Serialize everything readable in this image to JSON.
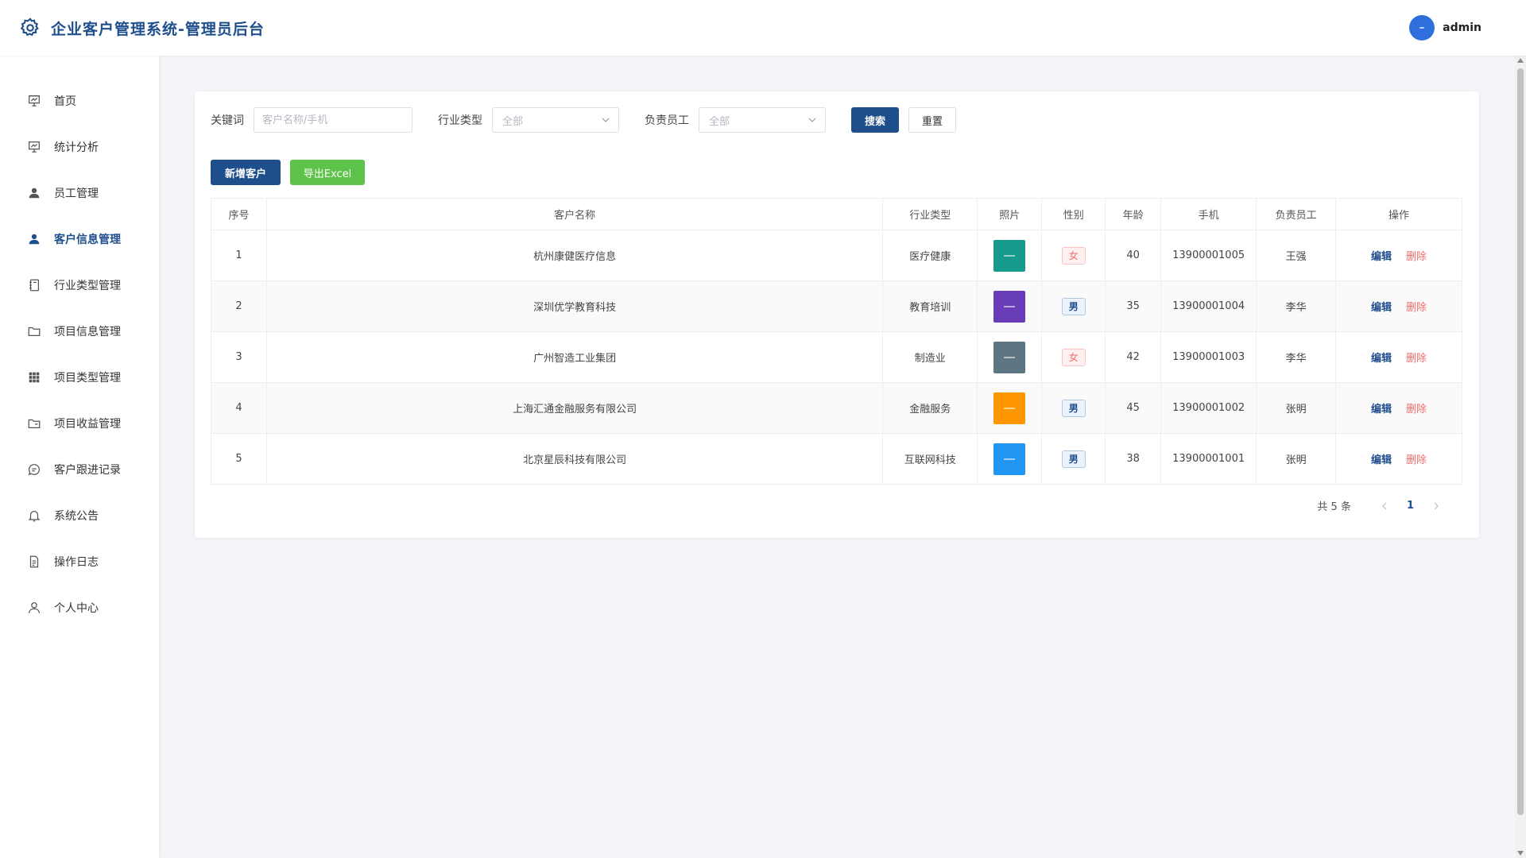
{
  "header": {
    "title": "企业客户管理系统-管理员后台",
    "username": "admin"
  },
  "sidebar": {
    "items": [
      {
        "label": "首页",
        "icon": "presentation-icon"
      },
      {
        "label": "统计分析",
        "icon": "presentation-icon"
      },
      {
        "label": "员工管理",
        "icon": "user-filled-icon"
      },
      {
        "label": "客户信息管理",
        "icon": "user-filled-icon",
        "active": true
      },
      {
        "label": "行业类型管理",
        "icon": "notebook-icon"
      },
      {
        "label": "项目信息管理",
        "icon": "folder-icon"
      },
      {
        "label": "项目类型管理",
        "icon": "grid-icon"
      },
      {
        "label": "项目收益管理",
        "icon": "folder-opened-icon"
      },
      {
        "label": "客户跟进记录",
        "icon": "chat-icon"
      },
      {
        "label": "系统公告",
        "icon": "bell-icon"
      },
      {
        "label": "操作日志",
        "icon": "document-icon"
      },
      {
        "label": "个人中心",
        "icon": "user-outline-icon"
      }
    ]
  },
  "filters": {
    "keyword_label": "关键词",
    "keyword_placeholder": "客户名称/手机",
    "industry_label": "行业类型",
    "industry_value": "全部",
    "staff_label": "负责员工",
    "staff_value": "全部",
    "search_label": "搜索",
    "reset_label": "重置"
  },
  "actions": {
    "add_label": "新增客户",
    "export_label": "导出Excel"
  },
  "table": {
    "columns": [
      "序号",
      "客户名称",
      "行业类型",
      "照片",
      "性别",
      "年龄",
      "手机",
      "负责员工",
      "操作"
    ],
    "edit_label": "编辑",
    "delete_label": "删除",
    "rows": [
      {
        "no": "1",
        "name": "杭州康健医疗信息",
        "industry": "医疗健康",
        "photo_color": "#159a8c",
        "gender": "女",
        "age": "40",
        "phone": "13900001005",
        "staff": "王强"
      },
      {
        "no": "2",
        "name": "深圳优学教育科技",
        "industry": "教育培训",
        "photo_color": "#6a3db8",
        "gender": "男",
        "age": "35",
        "phone": "13900001004",
        "staff": "李华"
      },
      {
        "no": "3",
        "name": "广州智造工业集团",
        "industry": "制造业",
        "photo_color": "#5e7683",
        "gender": "女",
        "age": "42",
        "phone": "13900001003",
        "staff": "李华"
      },
      {
        "no": "4",
        "name": "上海汇通金融服务有限公司",
        "industry": "金融服务",
        "photo_color": "#ff9800",
        "gender": "男",
        "age": "45",
        "phone": "13900001002",
        "staff": "张明"
      },
      {
        "no": "5",
        "name": "北京星辰科技有限公司",
        "industry": "互联网科技",
        "photo_color": "#2196f3",
        "gender": "男",
        "age": "38",
        "phone": "13900001001",
        "staff": "张明"
      }
    ]
  },
  "pagination": {
    "total_text": "共 5 条",
    "current_page": "1"
  }
}
